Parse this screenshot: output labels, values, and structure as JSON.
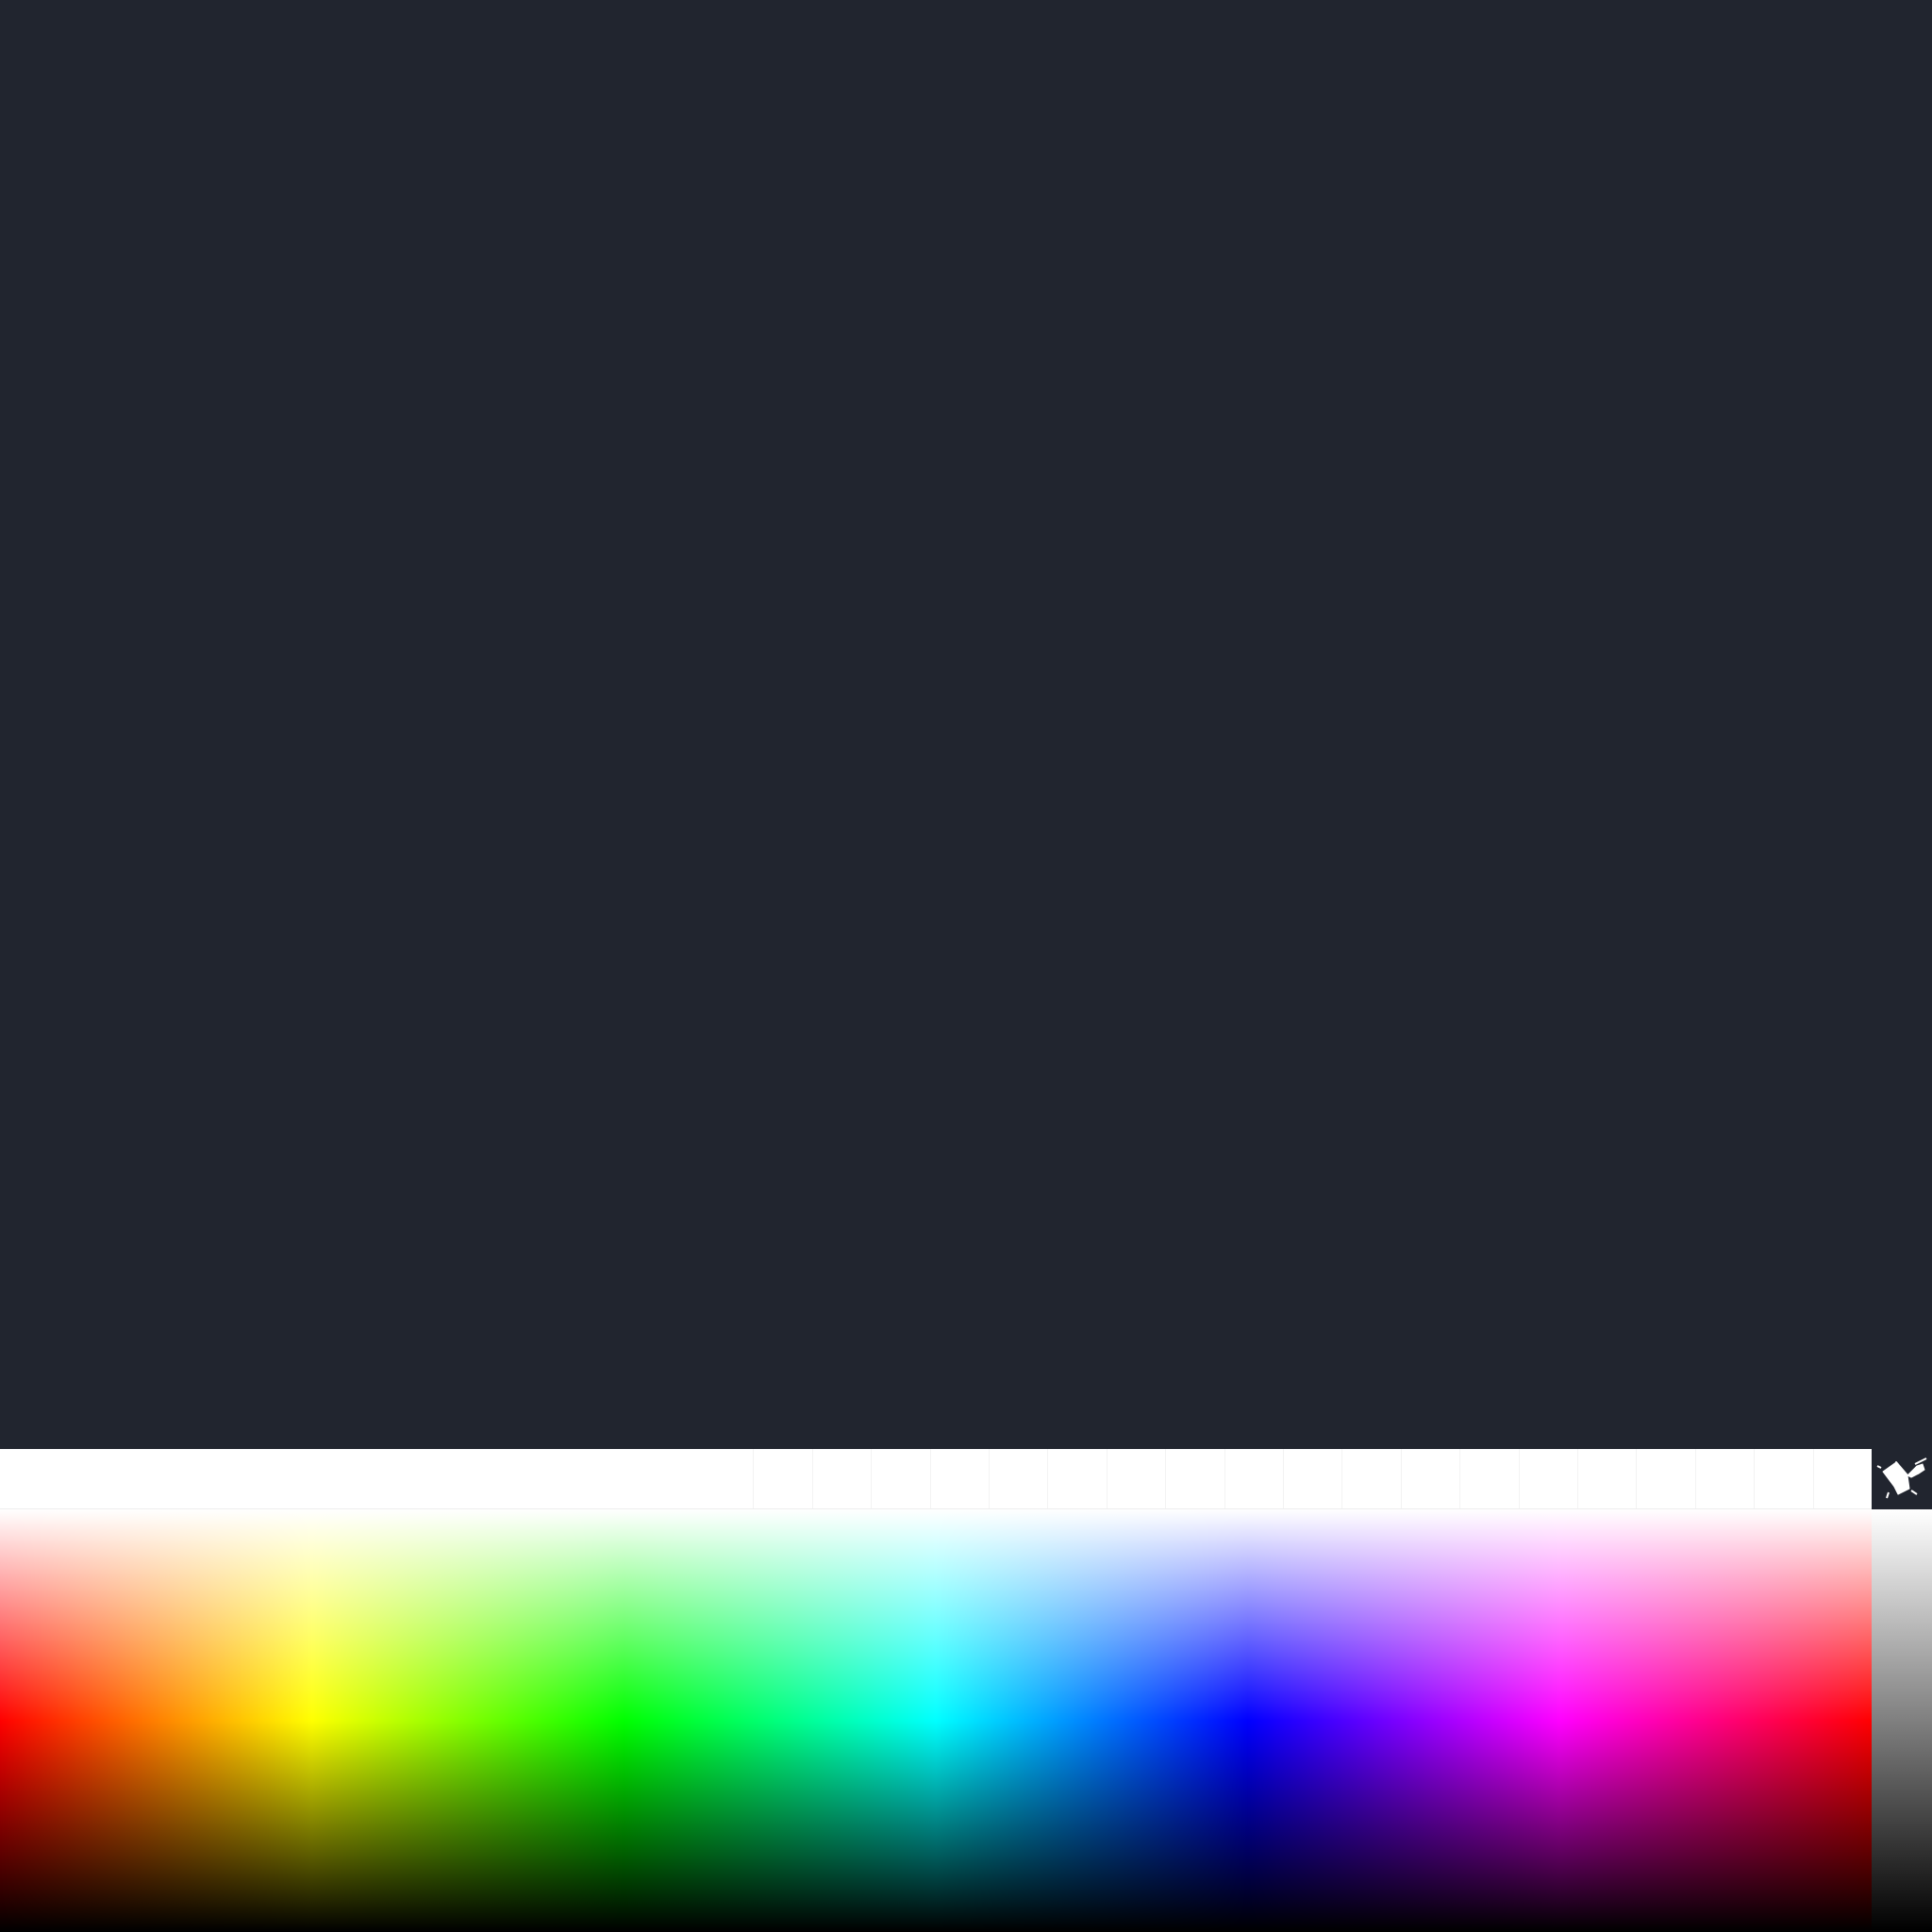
{
  "canvas": {
    "background_color": "#21252f"
  },
  "palette": {
    "swatches": [
      {
        "color": "#ffffff",
        "is_empty_slot": false
      },
      {
        "color": "#ffffff",
        "is_empty_slot": false
      },
      {
        "color": "#ffffff",
        "is_empty_slot": false
      },
      {
        "color": "#ffffff",
        "is_empty_slot": false
      },
      {
        "color": "#ffffff",
        "is_empty_slot": false
      },
      {
        "color": "#ffffff",
        "is_empty_slot": false
      },
      {
        "color": "#ffffff",
        "is_empty_slot": false
      },
      {
        "color": "#ffffff",
        "is_empty_slot": false
      },
      {
        "color": "#ffffff",
        "is_empty_slot": false
      },
      {
        "color": "#ffffff",
        "is_empty_slot": false
      },
      {
        "color": "#ffffff",
        "is_empty_slot": false
      },
      {
        "color": "#ffffff",
        "is_empty_slot": false
      },
      {
        "color": "#ffffff",
        "is_empty_slot": false
      },
      {
        "color": "#ffffff",
        "is_empty_slot": true
      },
      {
        "color": "#ffffff",
        "is_empty_slot": true
      },
      {
        "color": "#ffffff",
        "is_empty_slot": true
      },
      {
        "color": "#ffffff",
        "is_empty_slot": true
      },
      {
        "color": "#ffffff",
        "is_empty_slot": true
      },
      {
        "color": "#ffffff",
        "is_empty_slot": true
      },
      {
        "color": "#ffffff",
        "is_empty_slot": true
      },
      {
        "color": "#ffffff",
        "is_empty_slot": true
      },
      {
        "color": "#ffffff",
        "is_empty_slot": true
      },
      {
        "color": "#ffffff",
        "is_empty_slot": true
      },
      {
        "color": "#ffffff",
        "is_empty_slot": true
      },
      {
        "color": "#ffffff",
        "is_empty_slot": true
      },
      {
        "color": "#ffffff",
        "is_empty_slot": true
      },
      {
        "color": "#ffffff",
        "is_empty_slot": true
      },
      {
        "color": "#ffffff",
        "is_empty_slot": true
      },
      {
        "color": "#ffffff",
        "is_empty_slot": true
      },
      {
        "color": "#ffffff",
        "is_empty_slot": true
      },
      {
        "color": "#ffffff",
        "is_empty_slot": true
      },
      {
        "color": "#ffffff",
        "is_empty_slot": true
      }
    ]
  },
  "logo": {
    "icon": "paint-bucket-icon",
    "background_color": "#21252f",
    "icon_color": "#ffffff"
  },
  "color_picker": {
    "hue_spectrum": [
      "#ff0000",
      "#ffff00",
      "#00ff00",
      "#00ffff",
      "#0000ff",
      "#ff00ff",
      "#ff0000"
    ],
    "grayscale": [
      "#ffffff",
      "#000000"
    ]
  }
}
